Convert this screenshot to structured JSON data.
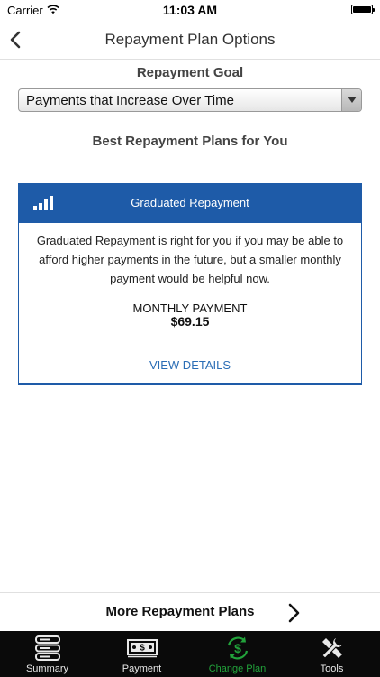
{
  "status_bar": {
    "carrier": "Carrier",
    "time": "11:03 AM"
  },
  "nav": {
    "title": "Repayment Plan Options"
  },
  "repayment_goal": {
    "label": "Repayment Goal",
    "selected": "Payments that Increase Over Time"
  },
  "best_plans": {
    "heading": "Best Repayment Plans for You"
  },
  "plan_card": {
    "title": "Graduated Repayment",
    "description": "Graduated Repayment is right for you if you may be able to afford higher payments in the future, but a smaller monthly payment would be helpful now.",
    "payment_label": "MONTHLY PAYMENT",
    "payment_amount": "$69.15",
    "view_details": "VIEW DETAILS",
    "header_color": "#1e5ba8",
    "icon": "graduated-bars-icon"
  },
  "more_plans": {
    "label": "More Repayment Plans"
  },
  "tab_bar": {
    "active_color": "#22a33b",
    "tabs": [
      {
        "label": "Summary",
        "icon": "server-stack-icon",
        "active": false
      },
      {
        "label": "Payment",
        "icon": "dollar-bill-icon",
        "active": false
      },
      {
        "label": "Change Plan",
        "icon": "dollar-cycle-icon",
        "active": true
      },
      {
        "label": "Tools",
        "icon": "wrench-screwdriver-icon",
        "active": false
      }
    ]
  }
}
